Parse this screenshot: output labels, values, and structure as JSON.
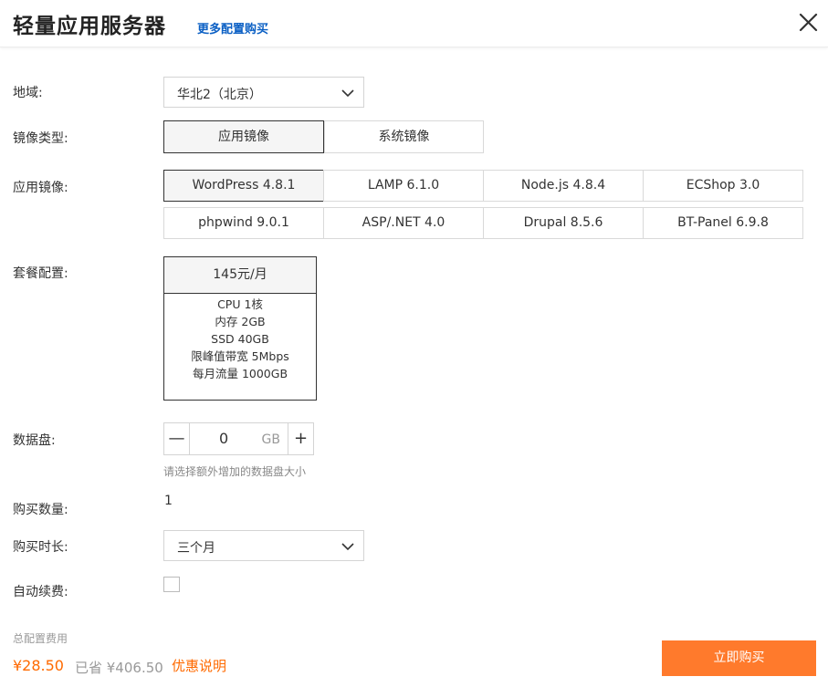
{
  "header": {
    "title": "轻量应用服务器",
    "more_link": "更多配置购买",
    "close_icon": "close-icon"
  },
  "region": {
    "label": "地域:",
    "value": "华北2（北京）",
    "icon": "chevron-down-icon"
  },
  "image_type": {
    "label": "镜像类型:",
    "options": [
      "应用镜像",
      "系统镜像"
    ],
    "selected": "应用镜像"
  },
  "app_image": {
    "label": "应用镜像:",
    "options": [
      "WordPress 4.8.1",
      "LAMP 6.1.0",
      "Node.js 4.8.4",
      "ECShop 3.0",
      "phpwind 9.0.1",
      "ASP/.NET 4.0",
      "Drupal 8.5.6",
      "BT-Panel 6.9.8"
    ],
    "selected": "WordPress 4.8.1"
  },
  "package": {
    "label": "套餐配置:",
    "price": "145元/月",
    "specs": [
      "CPU 1核",
      "内存 2GB",
      "SSD 40GB",
      "限峰值带宽 5Mbps",
      "每月流量 1000GB"
    ]
  },
  "disk": {
    "label": "数据盘:",
    "minus": "—",
    "value": "0",
    "unit": "GB",
    "plus": "+",
    "hint": "请选择额外增加的数据盘大小"
  },
  "quantity": {
    "label": "购买数量:",
    "value": "1"
  },
  "duration": {
    "label": "购买时长:",
    "value": "三个月",
    "icon": "chevron-down-icon"
  },
  "auto_renew": {
    "label": "自动续费:",
    "checked": false
  },
  "footer": {
    "total_label": "总配置费用",
    "price": "¥28.50",
    "saved": "已省 ¥406.50",
    "promo": "优惠说明",
    "buy_button": "立即购买"
  },
  "colors": {
    "accent": "#ff6a00",
    "button": "#ff7a2c",
    "link": "#0a5fc4"
  }
}
